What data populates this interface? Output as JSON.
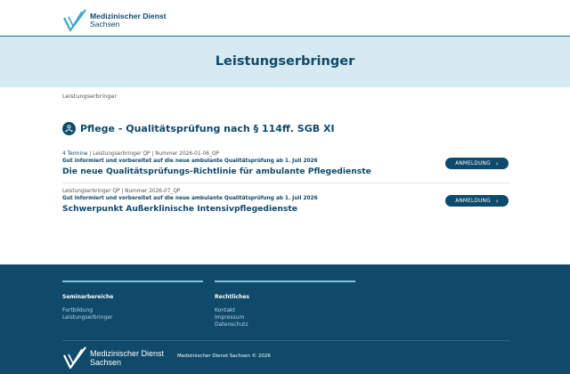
{
  "brand": {
    "line1": "Medizinischer Dienst",
    "line2": "Sachsen"
  },
  "hero": {
    "title": "Leistungserbringer"
  },
  "breadcrumb": "Leistungserbringer",
  "section": {
    "title": "Pflege - Qualitätsprüfung nach § 114ff. SGB XI"
  },
  "entries": [
    {
      "count": "4 Termine",
      "meta": " | Leistungserbringer QP | Nummer 2026-01-06_QP",
      "subtitle": "Gut informiert und vorbereitet auf die neue ambulante Qualitätsprüfung ab 1. Juli 2026",
      "title": "Die neue Qualitätsprüfungs-Richtlinie für ambulante Pflegedienste",
      "button": "ANMELDUNG"
    },
    {
      "count": "",
      "meta": "Leistungserbringer QP | Nummer 2026-07_QP",
      "subtitle": "Gut informiert und vorbereitet auf die neue ambulante Qualitätsprüfung ab 1. Juli 2026",
      "title": "Schwerpunkt Außerklinische Intensivpflegedienste",
      "button": "ANMELDUNG"
    }
  ],
  "footer": {
    "col1": {
      "heading": "Seminarbereiche",
      "links": [
        "Fortbildung",
        "Leistungserbringer"
      ]
    },
    "col2": {
      "heading": "Rechtliches",
      "links": [
        "Kontakt",
        "Impressum",
        "Datenschutz"
      ]
    },
    "brand": {
      "line1": "Medizinischer Dienst",
      "line2": "Sachsen"
    },
    "copyright": "Medizinischer Dienst Sachsen © 2026"
  },
  "colors": {
    "primary": "#0e4a6b",
    "hero_bg": "#d5eaf1",
    "footer_bg": "#0f4a6a",
    "accent": "#7fc3df"
  }
}
